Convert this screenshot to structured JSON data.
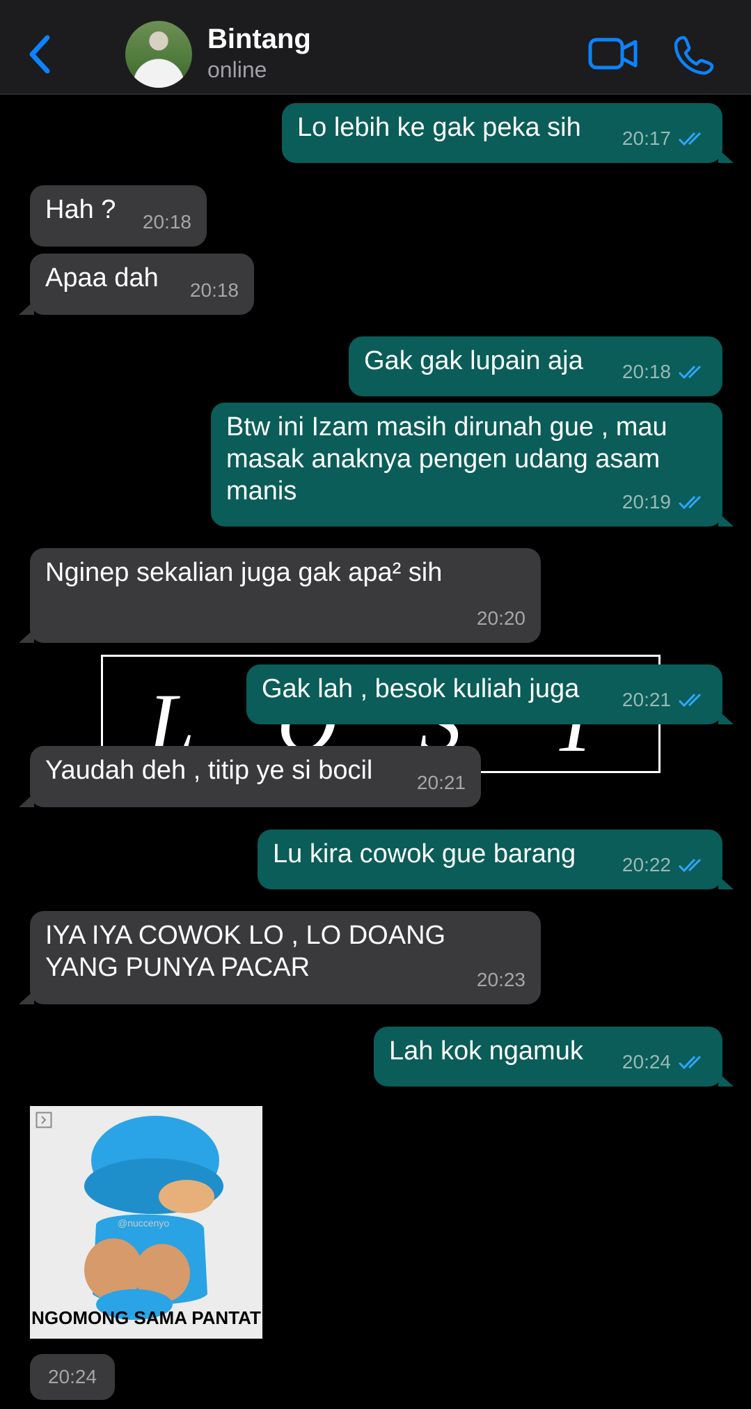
{
  "header": {
    "contact_name": "Bintang",
    "status": "online"
  },
  "colors": {
    "accent": "#0a84ff",
    "outgoing_bubble": "#0a5d58",
    "incoming_bubble": "#3a3a3c",
    "background": "#000000"
  },
  "messages": [
    {
      "direction": "out",
      "text": "Lo lebih ke gak peka sih",
      "time": "20:17"
    },
    {
      "direction": "in",
      "text": "Hah ?",
      "time": "20:18"
    },
    {
      "direction": "in",
      "text": "Apaa dah",
      "time": "20:18"
    },
    {
      "direction": "out",
      "text": "Gak gak lupain aja",
      "time": "20:18"
    },
    {
      "direction": "out",
      "text": "Btw ini Izam masih dirunah gue , mau masak anaknya pengen udang asam manis",
      "time": "20:19"
    },
    {
      "direction": "in",
      "text": "Nginep sekalian juga gak apa² sih",
      "time": "20:20"
    },
    {
      "direction": "out",
      "text": "Gak lah , besok kuliah juga",
      "time": "20:21"
    },
    {
      "direction": "in",
      "text": "Yaudah deh , titip ye si bocil",
      "time": "20:21"
    },
    {
      "direction": "out",
      "text": "Lu kira cowok gue barang",
      "time": "20:22"
    },
    {
      "direction": "in",
      "text": "IYA IYA COWOK LO , LO DOANG YANG PUNYA PACAR",
      "time": "20:23"
    },
    {
      "direction": "out",
      "text": "Lah kok ngamuk",
      "time": "20:24"
    }
  ],
  "background_image": {
    "letters": [
      "L",
      "O",
      "S",
      "T"
    ]
  },
  "sticker": {
    "caption": "NGOMONG SAMA PANTAT",
    "watermark": "@nuccenyo",
    "time": "20:24"
  },
  "icons": {
    "back": "chevron-left-icon",
    "video": "video-camera-icon",
    "call": "phone-icon",
    "read": "double-check-icon"
  }
}
